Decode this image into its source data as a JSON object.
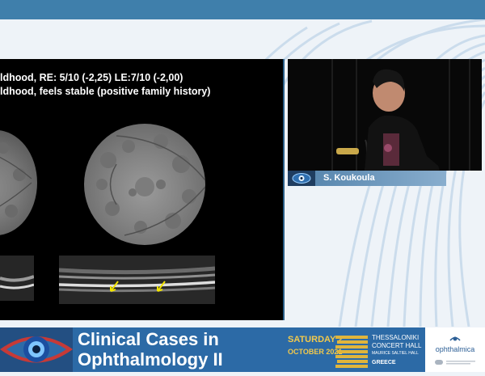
{
  "slide": {
    "line1": "ldhood, RE: 5/10 (-2,25)   LE:7/10 (-2,00)",
    "line2": "ldhood, feels stable (positive family history)"
  },
  "speaker": {
    "name": "S. Koukoula"
  },
  "banner": {
    "title_line1": "Clinical Cases in",
    "title_line2": "Ophthalmology II",
    "date_line1": "SATURDAY 2",
    "date_line2": "OCTOBER 2021",
    "venue_line1": "THESSALONIKI",
    "venue_line2": "CONCERT HALL",
    "venue_line3": "MAURICE SALTIEL HALL",
    "country": "GREECE",
    "brand": "ophthalmica"
  },
  "colors": {
    "banner_blue": "#2c6aa6",
    "top_bar": "#3f7fab",
    "date_yellow": "#f2c94c"
  }
}
